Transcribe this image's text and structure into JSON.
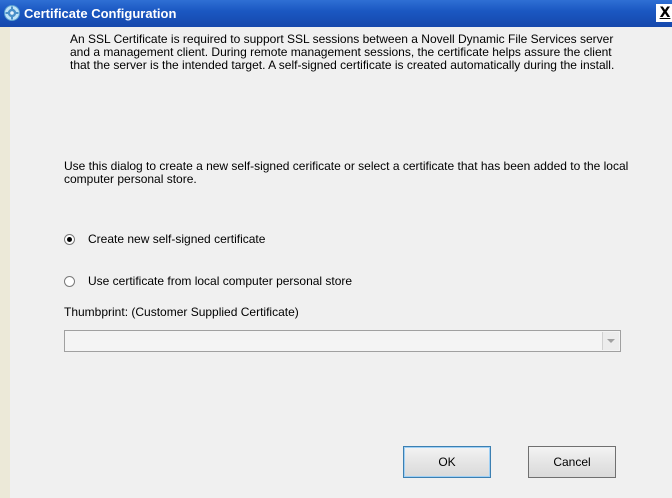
{
  "window": {
    "title": "Certificate Configuration",
    "title_icon": "certificate-gear-icon",
    "close_label": "X"
  },
  "intro_text": "An  SSL Certificate is required to support SSL sessions between a Novell Dynamic File Services server and a  management client. During remote management sessions, the certificate helps assure the client that the server is the intended target. A self-signed certificate is created automatically during the install.",
  "instructions_text": "Use this dialog to create a new self-signed cerificate or select a certificate that has been added  to the local computer personal store.",
  "options": [
    {
      "label": "Create new self-signed certificate",
      "selected": true
    },
    {
      "label": "Use certificate from local computer personal store",
      "selected": false
    }
  ],
  "thumbprint": {
    "label": "Thumbprint: (Customer Supplied Certificate)",
    "value": "",
    "enabled": false
  },
  "buttons": {
    "ok": "OK",
    "cancel": "Cancel"
  },
  "colors": {
    "titlebar": "#1b58c2",
    "dialog_background": "#f0f0f0",
    "default_button_border": "#3c7fb1"
  }
}
